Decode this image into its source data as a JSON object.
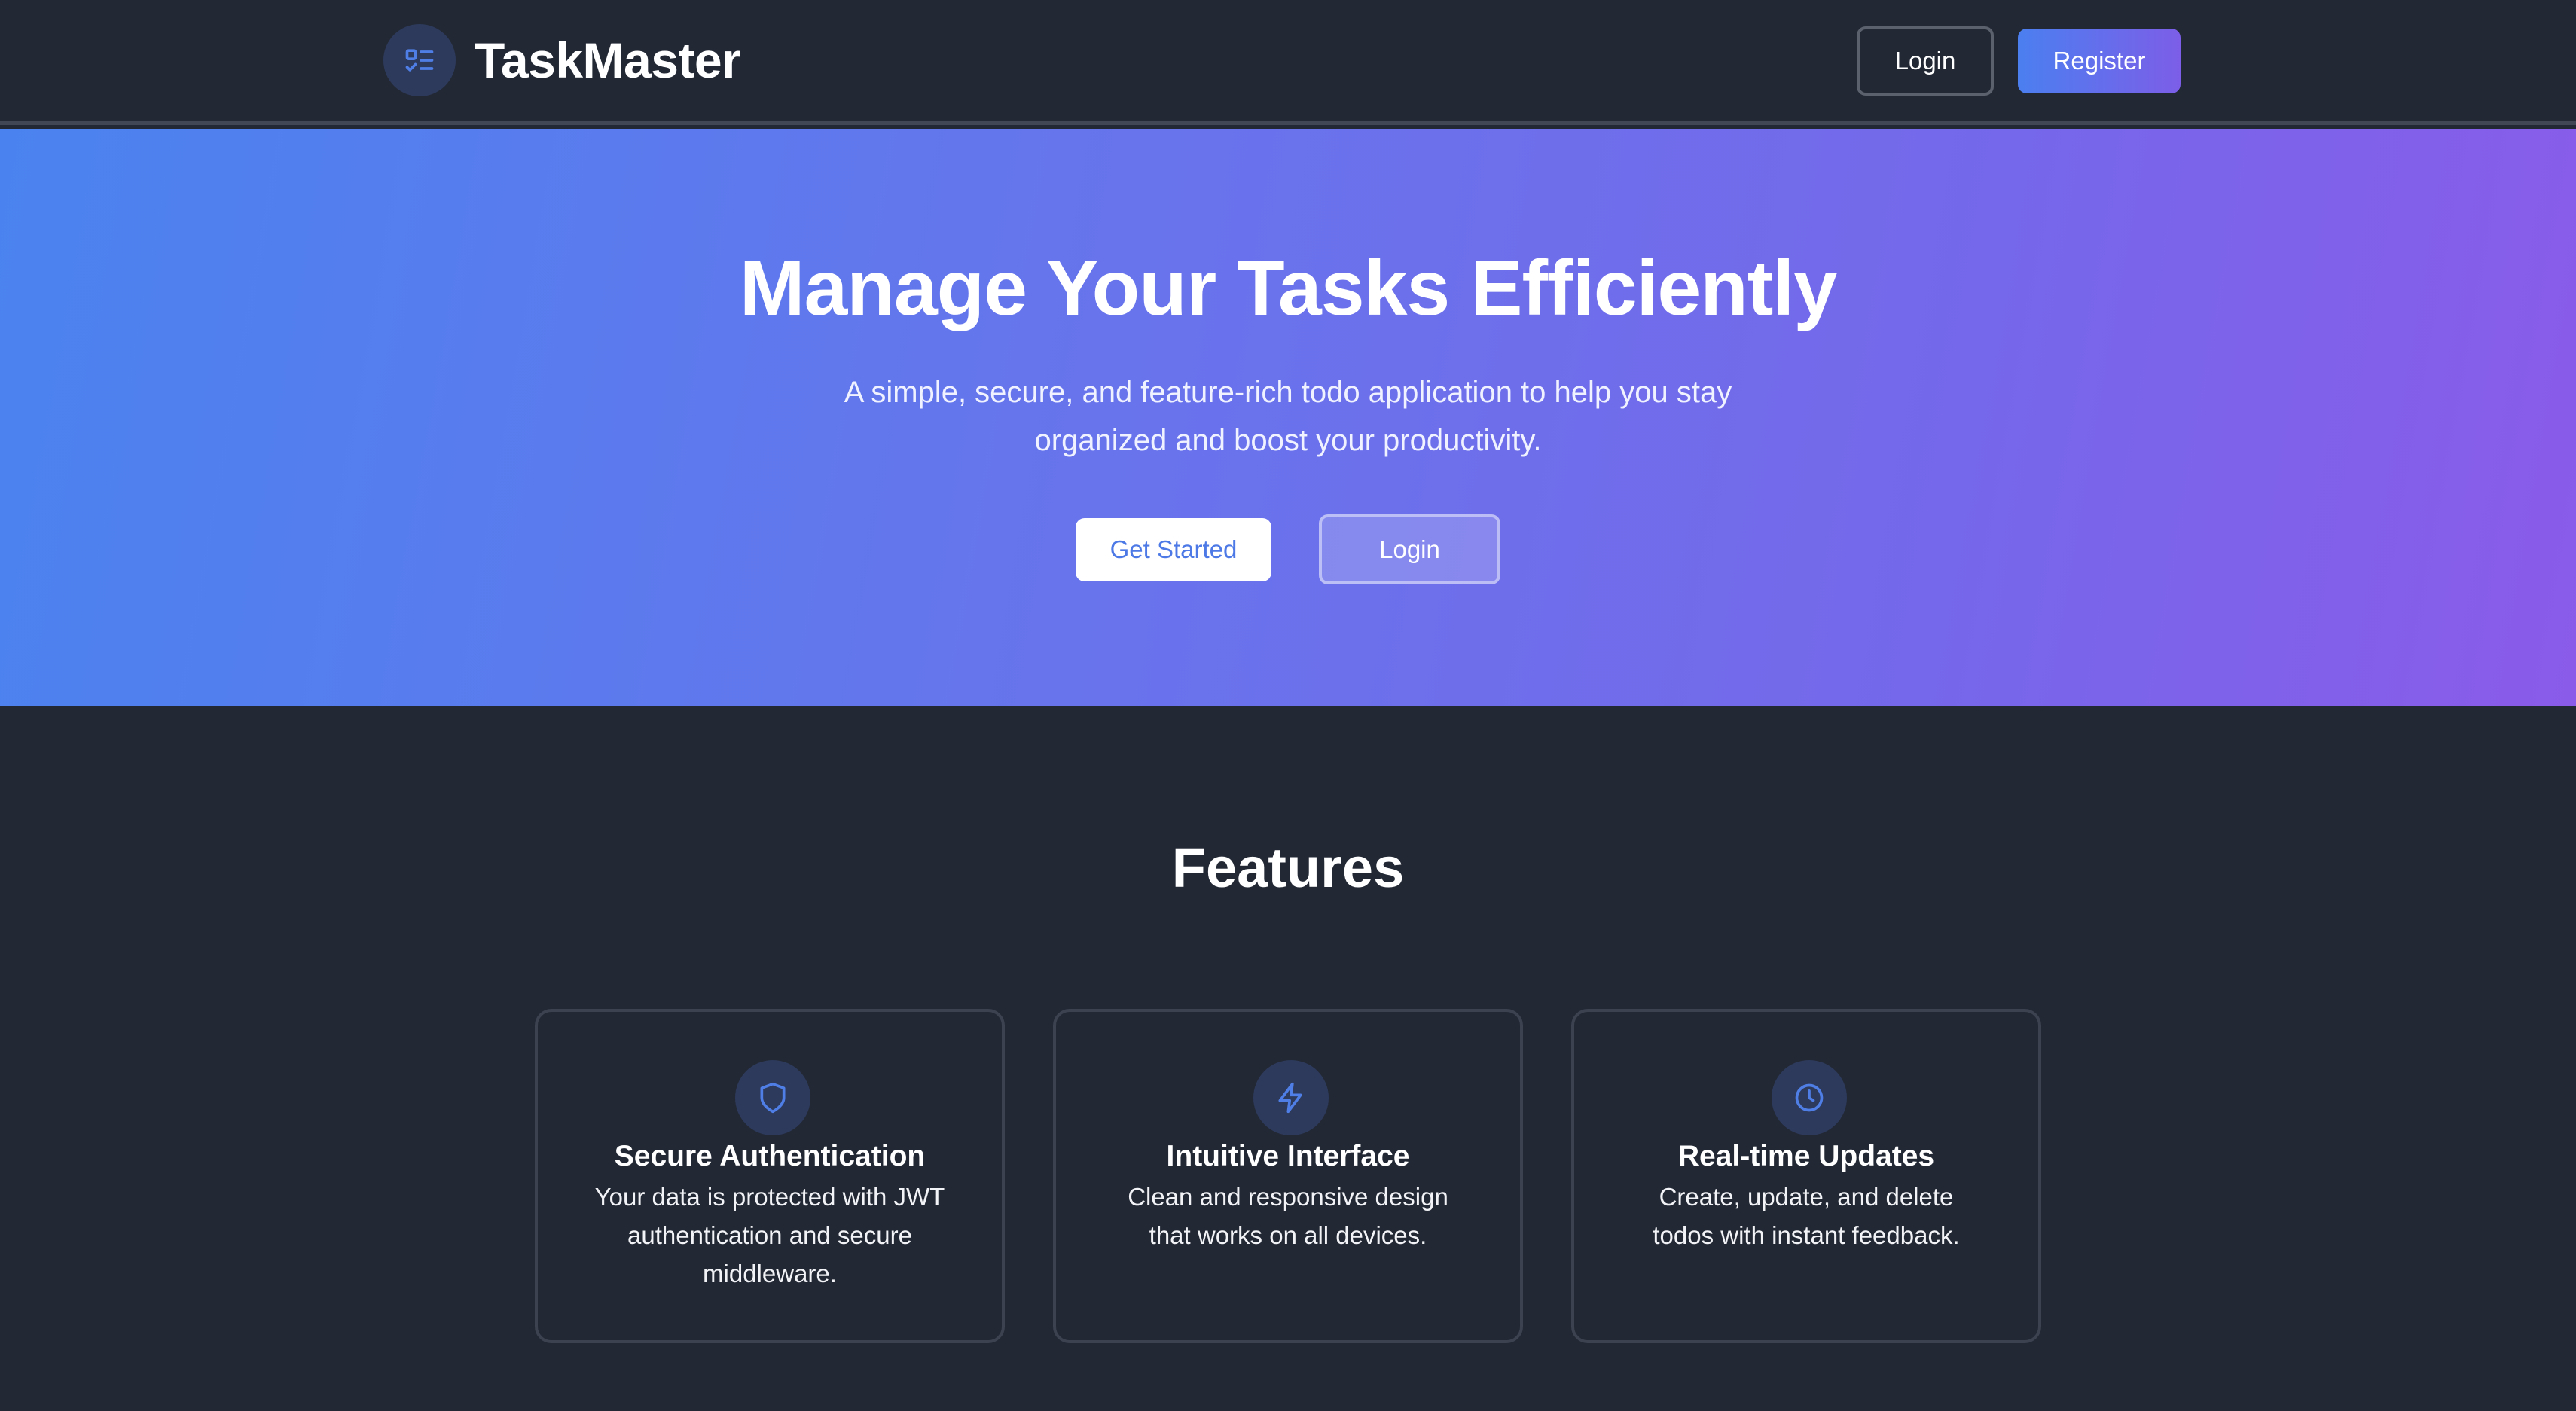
{
  "header": {
    "brand": {
      "title": "TaskMaster",
      "icon": "checklist-icon"
    },
    "login_label": "Login",
    "register_label": "Register"
  },
  "hero": {
    "title": "Manage Your Tasks Efficiently",
    "subtitle": "A simple, secure, and feature-rich todo application to help you stay organized and boost your productivity.",
    "get_started_label": "Get Started",
    "login_label": "Login"
  },
  "features": {
    "heading": "Features",
    "cards": [
      {
        "icon": "shield-icon",
        "title": "Secure Authentication",
        "text": "Your data is protected with JWT authentication and secure middleware."
      },
      {
        "icon": "lightning-icon",
        "title": "Intuitive Interface",
        "text": "Clean and responsive design that works on all devices."
      },
      {
        "icon": "clock-icon",
        "title": "Real-time Updates",
        "text": "Create, update, and delete todos with instant feedback."
      }
    ]
  },
  "colors": {
    "background": "#222834",
    "accent": "#4b7ff0",
    "accent_purple": "#8a5be9",
    "icon_circle": "#2d3a5c",
    "icon_stroke": "#4f7fe6"
  }
}
